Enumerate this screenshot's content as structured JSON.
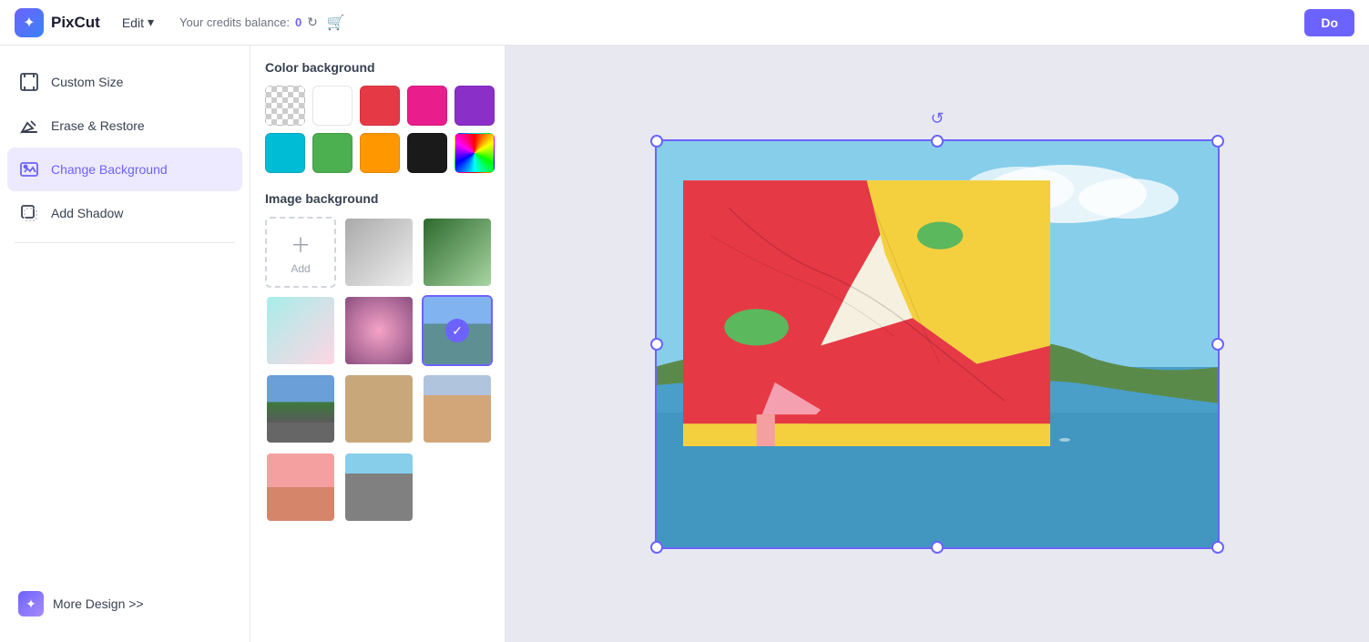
{
  "header": {
    "logo_text": "PixCut",
    "edit_label": "Edit",
    "credits_label": "Your credits balance:",
    "credits_value": "0",
    "done_label": "Do"
  },
  "sidebar": {
    "items": [
      {
        "id": "custom-size",
        "label": "Custom Size"
      },
      {
        "id": "erase-restore",
        "label": "Erase & Restore"
      },
      {
        "id": "change-background",
        "label": "Change Background",
        "active": true
      },
      {
        "id": "add-shadow",
        "label": "Add Shadow"
      }
    ],
    "more_design_label": "More Design >>"
  },
  "panel": {
    "color_bg_title": "Color background",
    "image_bg_title": "Image background",
    "add_label": "Add",
    "colors": [
      {
        "id": "transparent",
        "type": "transparent"
      },
      {
        "id": "white",
        "hex": "#ffffff"
      },
      {
        "id": "red",
        "hex": "#e63946"
      },
      {
        "id": "pink",
        "hex": "#e91e8c"
      },
      {
        "id": "purple",
        "hex": "#8b2fc9"
      },
      {
        "id": "cyan",
        "hex": "#00bcd4"
      },
      {
        "id": "green",
        "hex": "#4caf50"
      },
      {
        "id": "orange",
        "hex": "#ff9800"
      },
      {
        "id": "black",
        "hex": "#1a1a1a"
      },
      {
        "id": "gradient",
        "type": "gradient"
      }
    ]
  }
}
